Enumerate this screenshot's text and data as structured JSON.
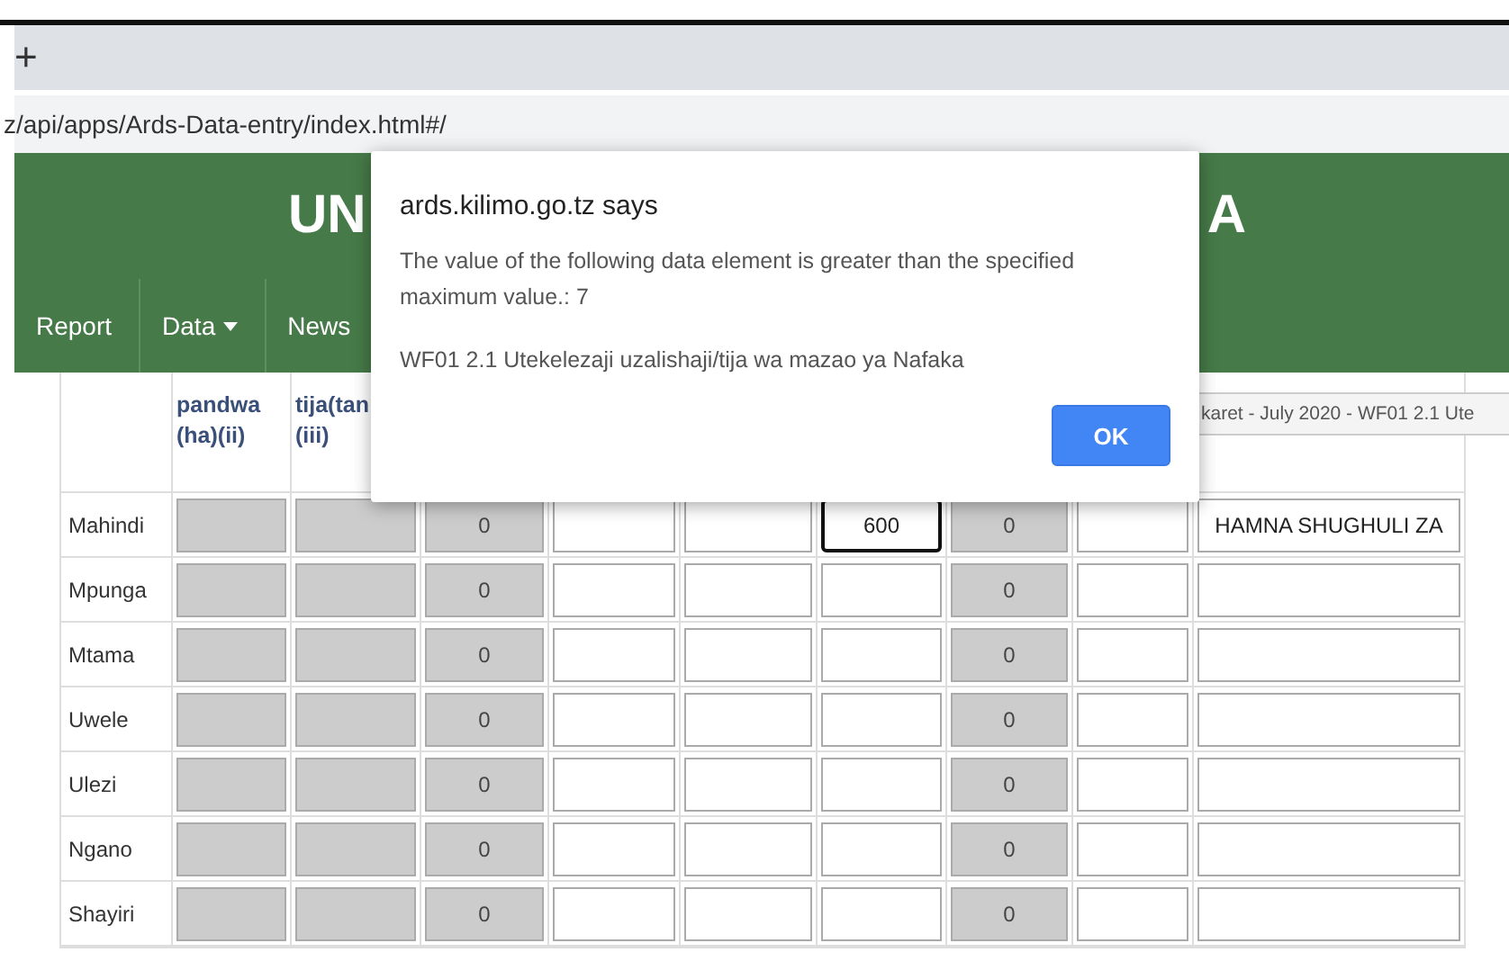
{
  "browser": {
    "new_tab": "+",
    "address": "z/api/apps/Ards-Data-entry/index.html#/"
  },
  "header": {
    "title_left": "UN",
    "title_right": "A",
    "nav": [
      {
        "label": "Report",
        "dropdown": false
      },
      {
        "label": "Data",
        "dropdown": true
      },
      {
        "label": "News",
        "dropdown": false
      }
    ]
  },
  "table": {
    "headers": [
      "pandwa\n(ha)(ii)",
      "tija(tan\n(iii)"
    ],
    "tooltip": "karet - July 2020 - WF01 2.1 Ute",
    "rows": [
      {
        "label": "Mahindi",
        "cells": [
          {
            "kind": "locked"
          },
          {
            "kind": "locked"
          },
          {
            "kind": "locked",
            "value": "0"
          },
          {
            "kind": "input"
          },
          {
            "kind": "input"
          },
          {
            "kind": "focused",
            "value": "600"
          },
          {
            "kind": "locked",
            "value": "0"
          },
          {
            "kind": "input"
          },
          {
            "kind": "input",
            "value": "HAMNA SHUGHULI ZA"
          }
        ]
      },
      {
        "label": "Mpunga",
        "cells": [
          {
            "kind": "locked"
          },
          {
            "kind": "locked"
          },
          {
            "kind": "locked",
            "value": "0"
          },
          {
            "kind": "input"
          },
          {
            "kind": "input"
          },
          {
            "kind": "input"
          },
          {
            "kind": "locked",
            "value": "0"
          },
          {
            "kind": "input"
          },
          {
            "kind": "input"
          }
        ]
      },
      {
        "label": "Mtama",
        "cells": [
          {
            "kind": "locked"
          },
          {
            "kind": "locked"
          },
          {
            "kind": "locked",
            "value": "0"
          },
          {
            "kind": "input"
          },
          {
            "kind": "input"
          },
          {
            "kind": "input"
          },
          {
            "kind": "locked",
            "value": "0"
          },
          {
            "kind": "input"
          },
          {
            "kind": "input"
          }
        ]
      },
      {
        "label": "Uwele",
        "cells": [
          {
            "kind": "locked"
          },
          {
            "kind": "locked"
          },
          {
            "kind": "locked",
            "value": "0"
          },
          {
            "kind": "input"
          },
          {
            "kind": "input"
          },
          {
            "kind": "input"
          },
          {
            "kind": "locked",
            "value": "0"
          },
          {
            "kind": "input"
          },
          {
            "kind": "input"
          }
        ]
      },
      {
        "label": "Ulezi",
        "cells": [
          {
            "kind": "locked"
          },
          {
            "kind": "locked"
          },
          {
            "kind": "locked",
            "value": "0"
          },
          {
            "kind": "input"
          },
          {
            "kind": "input"
          },
          {
            "kind": "input"
          },
          {
            "kind": "locked",
            "value": "0"
          },
          {
            "kind": "input"
          },
          {
            "kind": "input"
          }
        ]
      },
      {
        "label": "Ngano",
        "cells": [
          {
            "kind": "locked"
          },
          {
            "kind": "locked"
          },
          {
            "kind": "locked",
            "value": "0"
          },
          {
            "kind": "input"
          },
          {
            "kind": "input"
          },
          {
            "kind": "input"
          },
          {
            "kind": "locked",
            "value": "0"
          },
          {
            "kind": "input"
          },
          {
            "kind": "input"
          }
        ]
      },
      {
        "label": "Shayiri",
        "cells": [
          {
            "kind": "locked"
          },
          {
            "kind": "locked"
          },
          {
            "kind": "locked",
            "value": "0"
          },
          {
            "kind": "input"
          },
          {
            "kind": "input"
          },
          {
            "kind": "input"
          },
          {
            "kind": "locked",
            "value": "0"
          },
          {
            "kind": "input"
          },
          {
            "kind": "input"
          }
        ]
      }
    ]
  },
  "dialog": {
    "title": "ards.kilimo.go.tz says",
    "message": "The value of the following data element is greater than the specified maximum value.: 7",
    "detail": "WF01 2.1 Utekelezaji uzalishaji/tija wa mazao ya Nafaka",
    "button": "OK"
  }
}
